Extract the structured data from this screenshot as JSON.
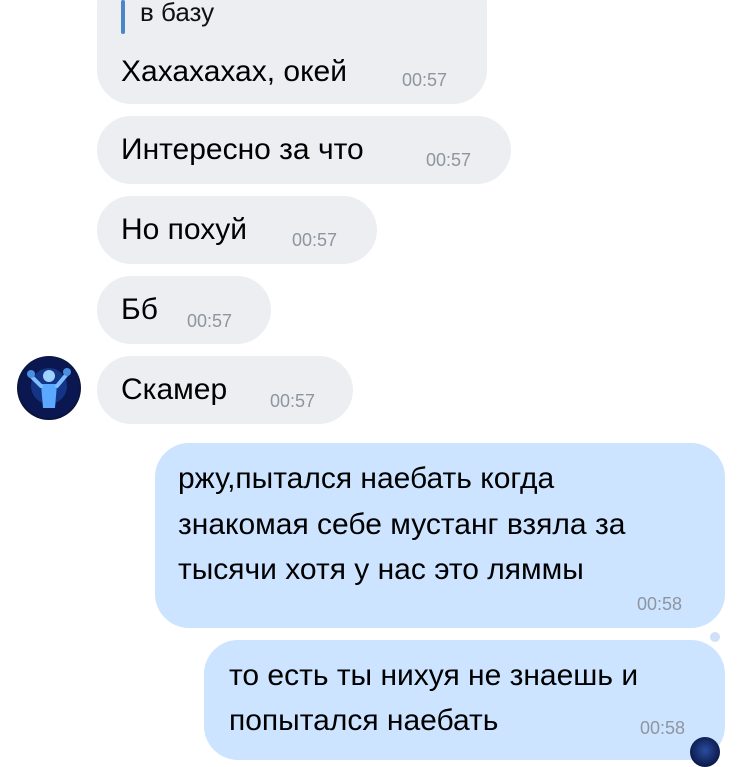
{
  "chat": {
    "reply_preview": {
      "text": "в базу"
    },
    "messages": [
      {
        "text": "Хахахахах, окей",
        "time": "00:57"
      },
      {
        "text": "Интересно за что",
        "time": "00:57"
      },
      {
        "text": "Но похуй",
        "time": "00:57"
      },
      {
        "text": "Бб",
        "time": "00:57"
      },
      {
        "text": "Скамер",
        "time": "00:57"
      }
    ],
    "outgoing": [
      {
        "lines": [
          "ржу,пытался наебать когда",
          "знакомая себе мустанг взяла за",
          "тысячи хотя у нас это ляммы"
        ],
        "time": "00:58"
      },
      {
        "lines": [
          "то есть ты нихуя не знаешь и",
          "попытался наебать"
        ],
        "time": "00:58"
      }
    ]
  },
  "colors": {
    "incoming_bubble": "#eceef2",
    "outgoing_bubble": "#cce4ff",
    "reply_accent": "#4a86c8",
    "timestamp": "#8f959e"
  },
  "icons": {
    "avatar": "user-avatar-icon"
  }
}
